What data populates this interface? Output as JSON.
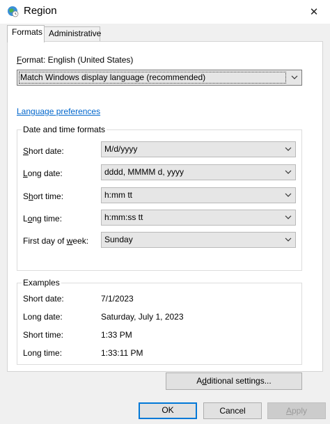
{
  "window": {
    "title": "Region",
    "close_glyph": "✕"
  },
  "tabs": [
    {
      "label": "Formats",
      "active": true
    },
    {
      "label": "Administrative",
      "active": false
    }
  ],
  "format": {
    "label_prefix": "F",
    "label_rest": "ormat: English (United States)",
    "selected": "Match Windows display language (recommended)"
  },
  "language_preferences_link": "Language preferences",
  "date_time_formats": {
    "title": "Date and time formats",
    "rows": [
      {
        "label_u": "S",
        "label_rest": "hort date:",
        "value": "M/d/yyyy"
      },
      {
        "label_u": "L",
        "label_rest": "ong date:",
        "value": "dddd, MMMM d, yyyy"
      },
      {
        "label_pre": "S",
        "label_u": "h",
        "label_rest": "ort time:",
        "value": "h:mm tt"
      },
      {
        "label_pre": "L",
        "label_u": "o",
        "label_rest": "ng time:",
        "value": "h:mm:ss tt"
      },
      {
        "label_pre": "First day of ",
        "label_u": "w",
        "label_rest": "eek:",
        "value": "Sunday"
      }
    ]
  },
  "examples": {
    "title": "Examples",
    "rows": [
      {
        "label": "Short date:",
        "value": "7/1/2023"
      },
      {
        "label": "Long date:",
        "value": "Saturday, July 1, 2023"
      },
      {
        "label": "Short time:",
        "value": "1:33 PM"
      },
      {
        "label": "Long time:",
        "value": "1:33:11 PM"
      }
    ]
  },
  "buttons": {
    "additional_pre": "A",
    "additional_u": "d",
    "additional_rest": "ditional settings...",
    "ok": "OK",
    "cancel": "Cancel",
    "apply_u": "A",
    "apply_rest": "pply"
  },
  "colors": {
    "accent": "#0078d7",
    "link": "#0066cc"
  }
}
